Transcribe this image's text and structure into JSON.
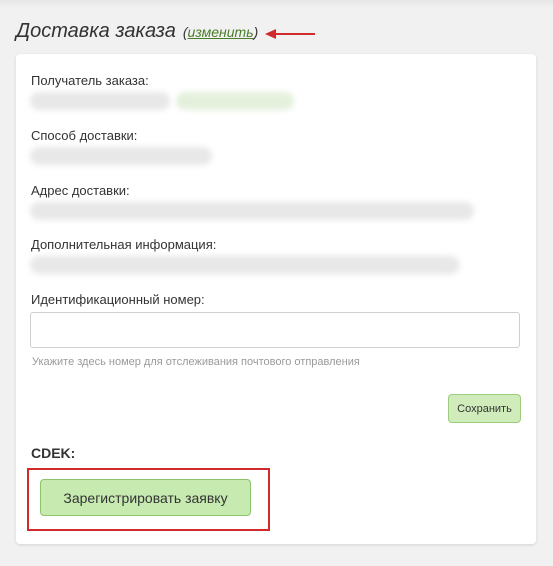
{
  "section": {
    "title": "Доставка заказа",
    "edit_open": "(",
    "edit_link": "изменить",
    "edit_close": ")"
  },
  "fields": {
    "recipient_label": "Получатель заказа:",
    "delivery_method_label": "Способ доставки:",
    "address_label": "Адрес доставки:",
    "additional_info_label": "Дополнительная информация:",
    "tracking_label": "Идентификационный номер:"
  },
  "tracking_input": {
    "value": "",
    "placeholder": ""
  },
  "tracking_hint": "Укажите здесь номер для отслеживания почтового отправления",
  "save_button": "Сохранить",
  "cdek": {
    "label": "CDEK:",
    "register_button": "Зарегистрировать заявку"
  },
  "colors": {
    "annotation_red": "#d12a2a",
    "button_green": "#c7eab0",
    "link_green": "#4a7d2a"
  },
  "icons": {
    "annotation_arrow": "red-arrow-icon"
  }
}
